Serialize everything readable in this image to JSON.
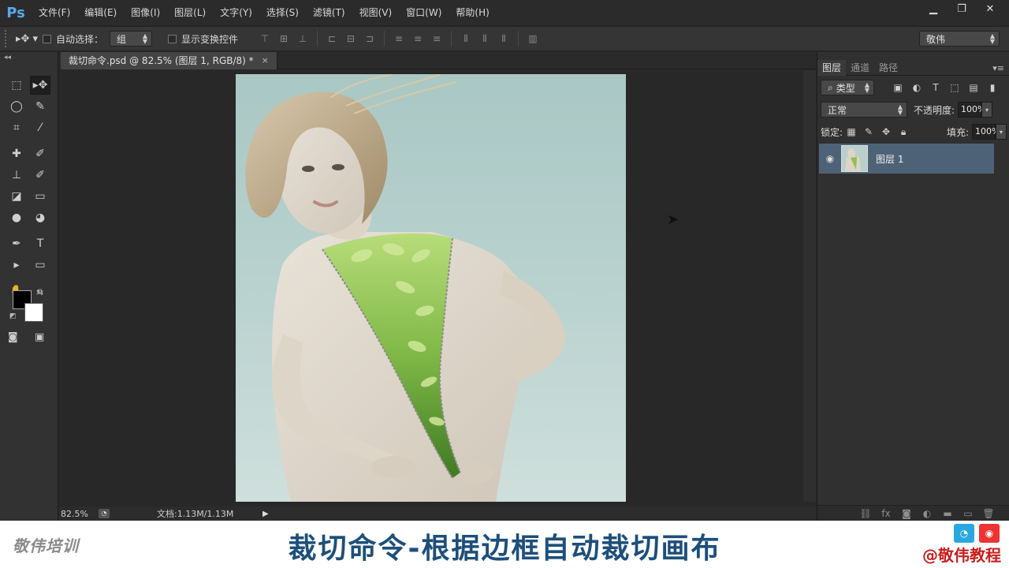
{
  "app": {
    "logo": "Ps"
  },
  "menu": [
    "文件(F)",
    "编辑(E)",
    "图像(I)",
    "图层(L)",
    "文字(Y)",
    "选择(S)",
    "滤镜(T)",
    "视图(V)",
    "窗口(W)",
    "帮助(H)"
  ],
  "window_controls": {
    "minimize": "▁",
    "restore": "❐",
    "close": "✕"
  },
  "options": {
    "auto_select_label": "自动选择：",
    "auto_select_value": "组",
    "show_transform_label": "显示变换控件",
    "workspace": "敬伟"
  },
  "document": {
    "tab_title": "裁切命令.psd @ 82.5% (图层 1, RGB/8) *",
    "close": "×",
    "zoom": "82.5%",
    "doc_size": "文档:1.13M/1.13M"
  },
  "layers_panel": {
    "tabs": [
      "图层",
      "通道",
      "路径"
    ],
    "filter_kind": "类型",
    "blend_mode": "正常",
    "opacity_label": "不透明度:",
    "opacity_value": "100%",
    "lock_label": "锁定:",
    "fill_label": "填充:",
    "fill_value": "100%",
    "layers": [
      {
        "name": "图层 1",
        "visible": true
      }
    ]
  },
  "banner": {
    "logo": "敬伟培训",
    "title": "裁切命令-根据边框自动裁切画布",
    "handle": "@敬伟教程"
  },
  "colors": {
    "accent_blue": "#1d4f7a",
    "selected_layer": "#4e6277",
    "handle_red": "#c81e1e"
  }
}
